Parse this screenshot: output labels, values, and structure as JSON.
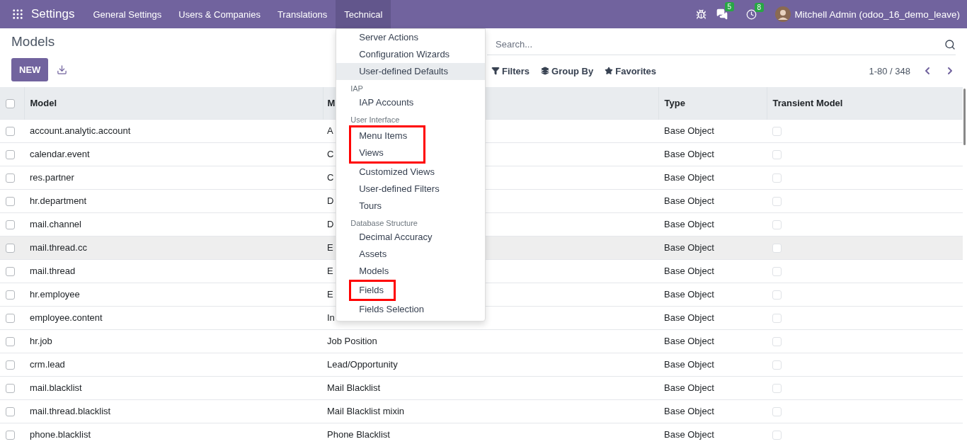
{
  "navbar": {
    "app_title": "Settings",
    "menu": [
      {
        "label": "General Settings",
        "selected": false
      },
      {
        "label": "Users & Companies",
        "selected": false
      },
      {
        "label": "Translations",
        "selected": false
      },
      {
        "label": "Technical",
        "selected": true
      }
    ],
    "messages_badge": "5",
    "activities_badge": "8",
    "user": "Mitchell Admin (odoo_16_demo_leave)"
  },
  "dropdown": {
    "sections": [
      {
        "items": [
          {
            "label": "Server Actions",
            "highlighted": false,
            "marked": false
          },
          {
            "label": "Configuration Wizards",
            "highlighted": false,
            "marked": false
          },
          {
            "label": "User-defined Defaults",
            "highlighted": true,
            "marked": false
          }
        ]
      },
      {
        "header": "IAP",
        "items": [
          {
            "label": "IAP Accounts",
            "highlighted": false,
            "marked": false
          }
        ]
      },
      {
        "header": "User Interface",
        "items": [
          {
            "label": "Menu Items",
            "highlighted": false,
            "marked": true
          },
          {
            "label": "Views",
            "highlighted": false,
            "marked": true
          },
          {
            "label": "Customized Views",
            "highlighted": false,
            "marked": false
          },
          {
            "label": "User-defined Filters",
            "highlighted": false,
            "marked": false
          },
          {
            "label": "Tours",
            "highlighted": false,
            "marked": false
          }
        ]
      },
      {
        "header": "Database Structure",
        "items": [
          {
            "label": "Decimal Accuracy",
            "highlighted": false,
            "marked": false
          },
          {
            "label": "Assets",
            "highlighted": false,
            "marked": false
          },
          {
            "label": "Models",
            "highlighted": false,
            "marked": false
          },
          {
            "label": "Fields",
            "highlighted": false,
            "marked": true
          },
          {
            "label": "Fields Selection",
            "highlighted": false,
            "marked": false
          }
        ]
      }
    ]
  },
  "page_title": "Models",
  "new_button": "NEW",
  "search": {
    "placeholder": "Search..."
  },
  "filters": [
    "Filters",
    "Group By",
    "Favorites"
  ],
  "pager": "1-80 / 348",
  "table": {
    "all_selected": false,
    "columns": [
      "Model",
      "M",
      "Type",
      "Transient Model"
    ],
    "rows": [
      {
        "model": "account.analytic.account",
        "column_2": "A",
        "type": "Base Object",
        "checked": false,
        "transient": false,
        "highlighted": false
      },
      {
        "model": "calendar.event",
        "column_2": "C",
        "type": "Base Object",
        "checked": false,
        "transient": false,
        "highlighted": false
      },
      {
        "model": "res.partner",
        "column_2": "C",
        "type": "Base Object",
        "checked": false,
        "transient": false,
        "highlighted": false
      },
      {
        "model": "hr.department",
        "column_2": "D",
        "type": "Base Object",
        "checked": false,
        "transient": false,
        "highlighted": false
      },
      {
        "model": "mail.channel",
        "column_2": "D",
        "type": "Base Object",
        "checked": false,
        "transient": false,
        "highlighted": false
      },
      {
        "model": "mail.thread.cc",
        "column_2": "E",
        "type": "Base Object",
        "checked": false,
        "transient": false,
        "highlighted": true
      },
      {
        "model": "mail.thread",
        "column_2": "E",
        "type": "Base Object",
        "checked": false,
        "transient": false,
        "highlighted": false
      },
      {
        "model": "hr.employee",
        "column_2": "E",
        "type": "Base Object",
        "checked": false,
        "transient": false,
        "highlighted": false
      },
      {
        "model": "employee.content",
        "column_2": "In",
        "type": "Base Object",
        "checked": false,
        "transient": false,
        "highlighted": false
      },
      {
        "model": "hr.job",
        "column_2": "Job Position",
        "type": "Base Object",
        "checked": false,
        "transient": false,
        "highlighted": false
      },
      {
        "model": "crm.lead",
        "column_2": "Lead/Opportunity",
        "type": "Base Object",
        "checked": false,
        "transient": false,
        "highlighted": false
      },
      {
        "model": "mail.blacklist",
        "column_2": "Mail Blacklist",
        "type": "Base Object",
        "checked": false,
        "transient": false,
        "highlighted": false
      },
      {
        "model": "mail.thread.blacklist",
        "column_2": "Mail Blacklist mixin",
        "type": "Base Object",
        "checked": false,
        "transient": false,
        "highlighted": false
      },
      {
        "model": "phone.blacklist",
        "column_2": "Phone Blacklist",
        "type": "Base Object",
        "checked": false,
        "transient": false,
        "highlighted": false
      }
    ]
  }
}
